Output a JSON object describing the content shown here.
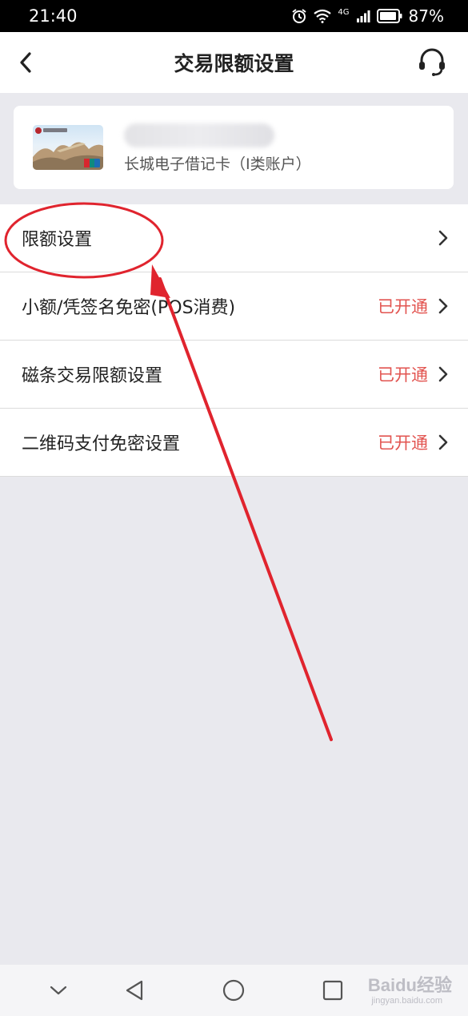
{
  "status_bar": {
    "time": "21:40",
    "network": "4G",
    "battery": "87%"
  },
  "header": {
    "title": "交易限额设置",
    "back_icon": "chevron-left-icon",
    "service_icon": "headset-icon"
  },
  "card": {
    "type_label": "长城电子借记卡（I类账户）"
  },
  "menu": {
    "items": [
      {
        "label": "限额设置",
        "status": ""
      },
      {
        "label": "小额/凭签名免密(POS消费)",
        "status": "已开通"
      },
      {
        "label": "磁条交易限额设置",
        "status": "已开通"
      },
      {
        "label": "二维码支付免密设置",
        "status": "已开通"
      }
    ]
  },
  "colors": {
    "status_enabled": "#e25450",
    "annotation": "#e0242e",
    "background": "#e9e9ee"
  },
  "watermark": {
    "brand": "Baidu经验",
    "url": "jingyan.baidu.com"
  }
}
